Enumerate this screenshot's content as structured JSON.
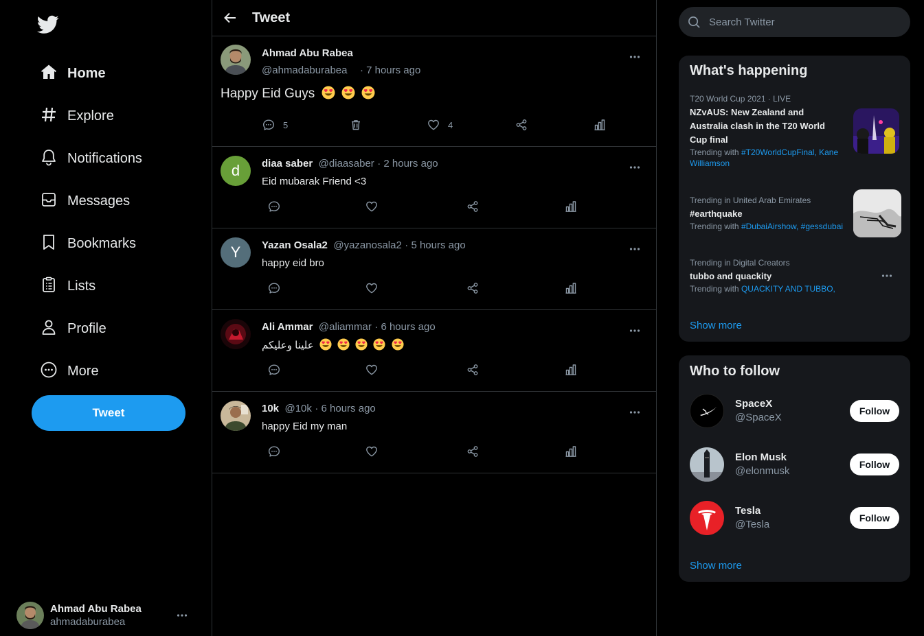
{
  "nav": {
    "items": [
      {
        "label": "Home",
        "icon": "home-icon"
      },
      {
        "label": "Explore",
        "icon": "hashtag-icon"
      },
      {
        "label": "Notifications",
        "icon": "bell-icon"
      },
      {
        "label": "Messages",
        "icon": "mail-icon"
      },
      {
        "label": "Bookmarks",
        "icon": "bookmark-icon"
      },
      {
        "label": "Lists",
        "icon": "list-icon"
      },
      {
        "label": "Profile",
        "icon": "user-icon"
      },
      {
        "label": "More",
        "icon": "more-circle-icon"
      }
    ],
    "tweet_button": "Tweet"
  },
  "account": {
    "name": "Ahmad Abu Rabea",
    "handle": "ahmadaburabea"
  },
  "header": {
    "title": "Tweet"
  },
  "main_tweet": {
    "name": "Ahmad Abu Rabea",
    "handle": "@ahmadaburabea",
    "time": "· 7 hours ago",
    "text": "Happy Eid Guys",
    "emoji_count": 3,
    "reply_count": "5",
    "like_count": "4"
  },
  "replies": [
    {
      "name": "diaa saber",
      "handle": "@diaasaber",
      "time": "· 2 hours ago",
      "text": "Eid mubarak Friend <3",
      "avatar_letter": "d",
      "avatar_color": "#689f38"
    },
    {
      "name": "Yazan Osala2",
      "handle": "@yazanosala2",
      "time": "· 5 hours ago",
      "text": "happy eid bro",
      "avatar_letter": "Y",
      "avatar_color": "#546e7a"
    },
    {
      "name": "Ali Ammar",
      "handle": "@aliammar",
      "time": "· 6 hours ago",
      "text": "علينا وعليكم",
      "emoji_count": 5
    },
    {
      "name": "10k",
      "handle": "@10k",
      "time": "· 6 hours ago",
      "text": "happy Eid my man"
    }
  ],
  "search": {
    "placeholder": "Search Twitter"
  },
  "trends": {
    "title": "What's happening",
    "items": [
      {
        "meta": "T20 World Cup 2021 · LIVE",
        "title_lines": [
          "NZvAUS: New Zealand and",
          "Australia clash in the T20 World",
          "Cup final"
        ],
        "with_label": "Trending with",
        "tags_line1": "#T20WorldCupFinal, Kane",
        "tags_line2": "Williamson"
      },
      {
        "meta": "Trending in United Arab Emirates",
        "title_lines": [
          "#earthquake"
        ],
        "with_label": "Trending with",
        "tags_line1": "#DubaiAirshow, #gessdubai"
      },
      {
        "meta": "Trending in Digital Creators",
        "title_lines": [
          "tubbo and quackity"
        ],
        "with_label": "Trending with",
        "tags_line1": "QUACKITY AND TUBBO,"
      }
    ],
    "show_more": "Show more"
  },
  "who_to_follow": {
    "title": "Who to follow",
    "items": [
      {
        "name": "SpaceX",
        "handle": "@SpaceX",
        "button": "Follow"
      },
      {
        "name": "Elon Musk",
        "handle": "@elonmusk",
        "button": "Follow"
      },
      {
        "name": "Tesla",
        "handle": "@Tesla",
        "button": "Follow"
      }
    ],
    "show_more": "Show more"
  },
  "colors": {
    "accent": "#1d9bf0",
    "background": "#000000",
    "panel": "#16181c",
    "border": "#2f3336",
    "muted_text": "#8b98a5",
    "tesla_red": "#e82127"
  }
}
